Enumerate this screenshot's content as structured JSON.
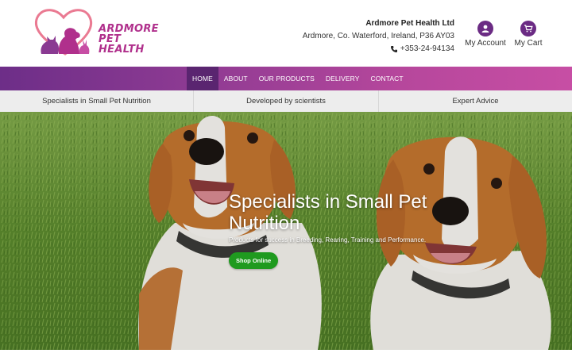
{
  "brand": {
    "logo_line1": "ARDMORE",
    "logo_line2": "PET HEALTH",
    "logo_icon": "heart-pets-logo"
  },
  "contact": {
    "company_name": "Ardmore Pet Health Ltd",
    "address": "Ardmore, Co. Waterford, Ireland, P36 AY03",
    "phone": "+353-24-94134",
    "phone_icon": "phone-icon"
  },
  "account": {
    "my_account_label": "My Account",
    "my_account_icon": "user-icon",
    "my_cart_label": "My Cart",
    "my_cart_icon": "cart-icon"
  },
  "nav": {
    "items": [
      {
        "label": "HOME",
        "active": true
      },
      {
        "label": "ABOUT",
        "active": false
      },
      {
        "label": "OUR PRODUCTS",
        "active": false
      },
      {
        "label": "DELIVERY",
        "active": false
      },
      {
        "label": "CONTACT",
        "active": false
      }
    ]
  },
  "features": [
    "Specialists in Small Pet Nutrition",
    "Developed by scientists",
    "Expert Advice"
  ],
  "hero": {
    "title": "Specialists in Small Pet Nutrition",
    "subtitle": "Products for success in Breeding, Rearing, Training and Performance.",
    "button_label": "Shop Online"
  },
  "colors": {
    "brand_purple": "#6b2b84",
    "brand_pink": "#c74ea4",
    "logo_pink": "#e86a8a",
    "button_green": "#1f9a1f"
  }
}
